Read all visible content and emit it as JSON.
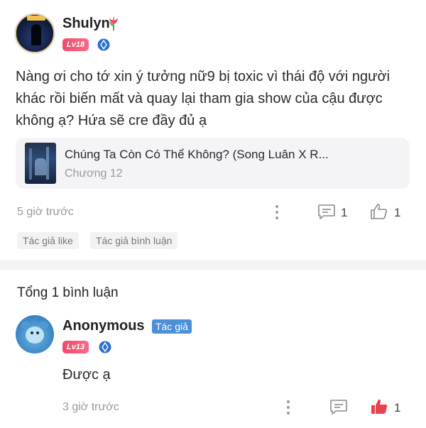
{
  "post": {
    "username": "Shulyn",
    "username_icon": "tulip-icon",
    "level": "Lv18",
    "text": "Nàng ơi cho tớ xin ý tưởng nữ9 bị toxic vì thái độ với người khác rồi biến mất và quay lại tham gia show của cậu được không ạ? Hứa sẽ cre đầy đủ ạ",
    "book": {
      "title": "Chúng Ta Còn Có Thể Không? (Song Luân X R...",
      "chapter": "Chương 12"
    },
    "time": "5 giờ trước",
    "comment_count": "1",
    "like_count": "1",
    "chips": [
      "Tác giả like",
      "Tác giả bình luận"
    ]
  },
  "comments_header": "Tổng 1 bình luận",
  "reply": {
    "username": "Anonymous",
    "author_badge": "Tác giả",
    "level": "Lv13",
    "text": "Được ạ",
    "time": "3 giờ trước",
    "like_count": "1"
  },
  "colors": {
    "level_badge": "#f04b6a",
    "author_badge": "#4a8fd8",
    "liked": "#e8414f",
    "muted_text": "#9a9a9a"
  }
}
